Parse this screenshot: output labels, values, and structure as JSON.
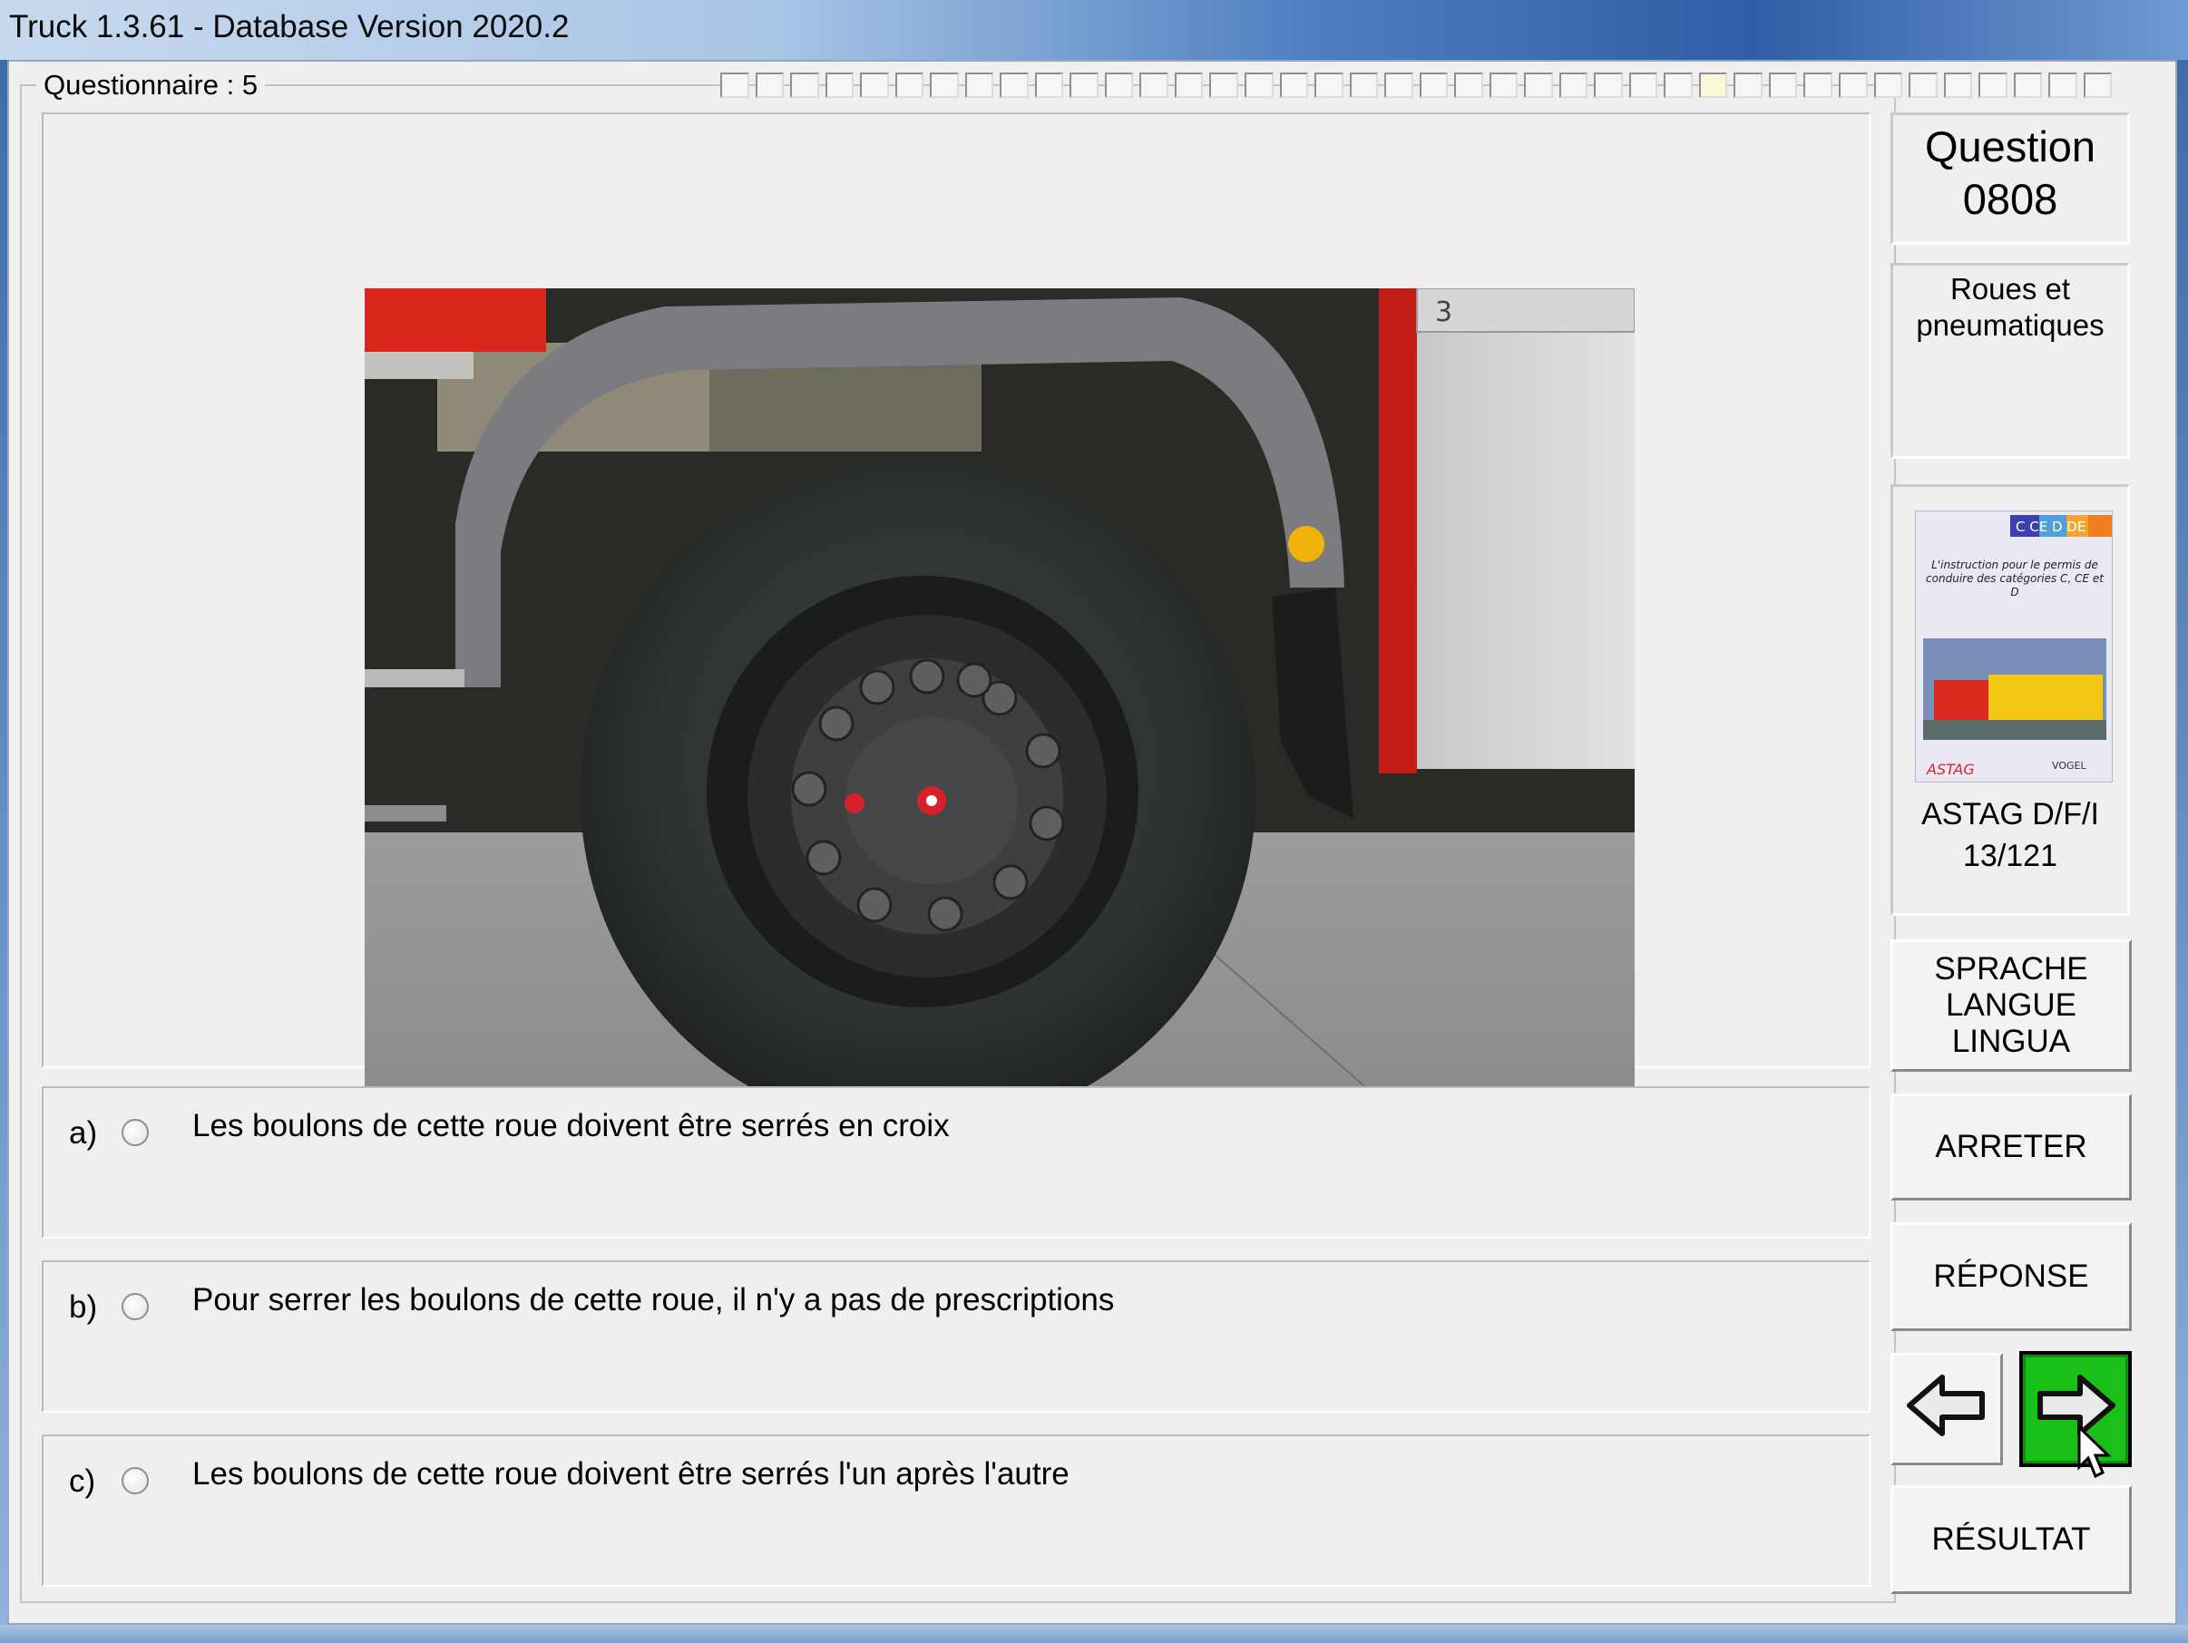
{
  "window": {
    "title": "Truck 1.3.61 - Database Version 2020.2"
  },
  "questionnaire": {
    "label": "Questionnaire : 5",
    "progress_total": 40,
    "progress_current": 29
  },
  "question": {
    "title_line1": "Question",
    "title_line2": "0808",
    "topic_line1": "Roues et",
    "topic_line2": "pneumatiques"
  },
  "reference": {
    "book_tag": "C CE D DE",
    "book_title": "L'instruction pour le permis de conduire des catégories C, CE et D",
    "publisher_left": "ASTAG",
    "publisher_right": "VOGEL",
    "caption_line1": "ASTAG D/F/I",
    "caption_line2": "13/121"
  },
  "answers": [
    {
      "letter": "a)",
      "text": "Les boulons de cette roue doivent être serrés en croix"
    },
    {
      "letter": "b)",
      "text": "Pour serrer les boulons de cette roue, il n'y a pas de prescriptions"
    },
    {
      "letter": "c)",
      "text": "Les boulons de cette roue doivent être serrés l'un après l'autre"
    }
  ],
  "photo": {
    "panel_number": "3"
  },
  "buttons": {
    "language_line1": "SPRACHE",
    "language_line2": "LANGUE",
    "language_line3": "LINGUA",
    "stop": "ARRETER",
    "answer": "RÉPONSE",
    "result": "RÉSULTAT",
    "prev_icon": "arrow-left-icon",
    "next_icon": "arrow-right-icon"
  },
  "colors": {
    "next_button": "#18c018",
    "truck_red": "#d9261c"
  }
}
